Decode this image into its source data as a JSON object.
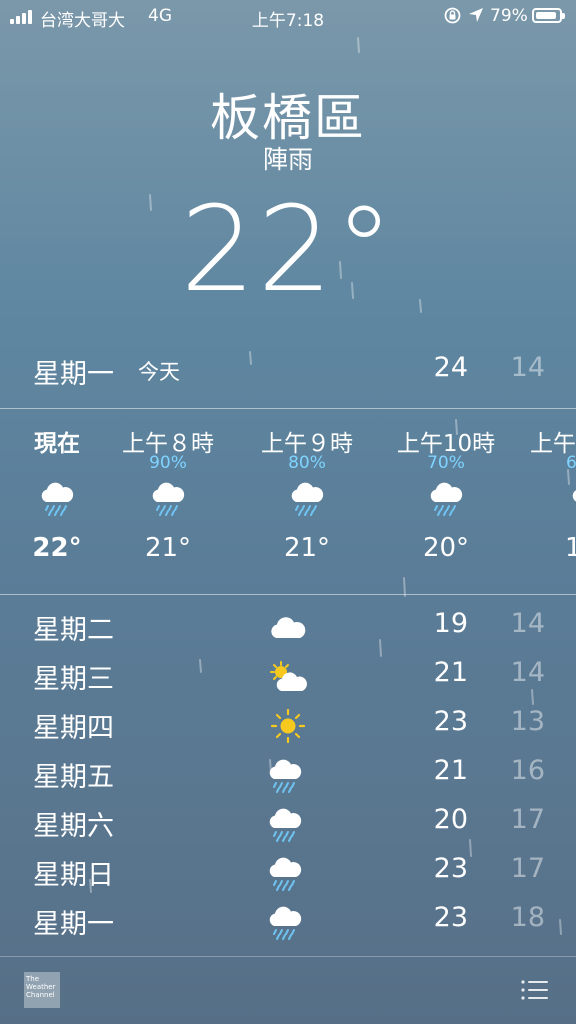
{
  "status_bar": {
    "carrier": "台湾大哥大",
    "network": "4G",
    "time": "上午7:18",
    "battery": "79%"
  },
  "header": {
    "city": "板橋區",
    "condition": "陣雨",
    "temperature": "22°"
  },
  "today": {
    "day": "星期一",
    "label": "今天",
    "high": "24",
    "low": "14"
  },
  "hourly": [
    {
      "time": "現在",
      "precip": "",
      "icon": "rain-cloud-icon",
      "temp": "22°"
    },
    {
      "time": "上午８時",
      "precip": "90%",
      "icon": "rain-cloud-icon",
      "temp": "21°"
    },
    {
      "time": "上午９時",
      "precip": "80%",
      "icon": "rain-cloud-icon",
      "temp": "21°"
    },
    {
      "time": "上午10時",
      "precip": "70%",
      "icon": "rain-cloud-icon",
      "temp": "20°"
    },
    {
      "time": "上午",
      "precip": "6",
      "icon": "rain-cloud-icon",
      "temp": "1"
    }
  ],
  "daily": [
    {
      "day": "星期二",
      "icon": "cloud-icon",
      "high": "19",
      "low": "14"
    },
    {
      "day": "星期三",
      "icon": "partly-sunny-icon",
      "high": "21",
      "low": "14"
    },
    {
      "day": "星期四",
      "icon": "sun-icon",
      "high": "23",
      "low": "13"
    },
    {
      "day": "星期五",
      "icon": "rain-cloud-icon",
      "high": "21",
      "low": "16"
    },
    {
      "day": "星期六",
      "icon": "rain-cloud-icon",
      "high": "20",
      "low": "17"
    },
    {
      "day": "星期日",
      "icon": "rain-cloud-icon",
      "high": "23",
      "low": "17"
    },
    {
      "day": "星期一",
      "icon": "rain-cloud-icon",
      "high": "23",
      "low": "18"
    }
  ],
  "toolbar": {
    "logo": "The Weather Channel"
  },
  "colors": {
    "precip_blue": "#7fd3ff",
    "sun_yellow": "#f7c91e",
    "low_temp": "rgba(255,255,255,0.45)"
  }
}
